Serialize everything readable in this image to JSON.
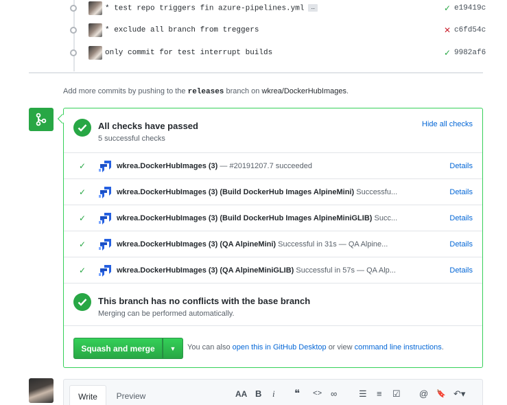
{
  "commits": [
    {
      "message": "* test repo triggers fin azure-pipelines.yml",
      "has_ellipsis": true,
      "ellipsis": "…",
      "status": "success",
      "status_glyph": "✓",
      "sha": "e19419c"
    },
    {
      "message": "* exclude all branch from treggers",
      "status": "failure",
      "status_glyph": "✕",
      "sha": "c6fd54c"
    },
    {
      "message": "only commit for test interrupt builds",
      "status": "success",
      "status_glyph": "✓",
      "sha": "9982af6"
    }
  ],
  "add_more": {
    "prefix": "Add more commits by pushing to the",
    "branch": "releases",
    "middle": "branch on",
    "repo": "wkrea/DockerHubImages",
    "suffix": "."
  },
  "checks": {
    "title": "All checks have passed",
    "subtitle": "5 successful checks",
    "hide_label": "Hide all checks",
    "items": [
      {
        "name": "wkrea.DockerHubImages (3)",
        "desc": "— #20191207.7 succeeded",
        "details": "Details"
      },
      {
        "name": "wkrea.DockerHubImages (3) (Build DockerHub Images AlpineMini)",
        "desc": "Successfu...",
        "details": "Details"
      },
      {
        "name": "wkrea.DockerHubImages (3) (Build DockerHub Images AlpineMiniGLIB)",
        "desc": "Succ...",
        "details": "Details"
      },
      {
        "name": "wkrea.DockerHubImages (3) (QA AlpineMini)",
        "desc": "Successful in 31s — QA Alpine...",
        "details": "Details"
      },
      {
        "name": "wkrea.DockerHubImages (3) (QA AlpineMiniGLIB)",
        "desc": "Successful in 57s — QA Alp...",
        "details": "Details"
      }
    ]
  },
  "conflicts": {
    "title": "This branch has no conflicts with the base branch",
    "subtitle": "Merging can be performed automatically."
  },
  "merge": {
    "button_label": "Squash and merge",
    "caret": "▼",
    "also_prefix": "You can also",
    "desktop_link": "open this in GitHub Desktop",
    "or_view": "or view",
    "cli_link": "command line instructions",
    "suffix": "."
  },
  "comment": {
    "write_tab": "Write",
    "preview_tab": "Preview",
    "toolbar": {
      "heading": "AA",
      "bold": "B",
      "italic": "i",
      "quote": "❝",
      "code": "<>",
      "link": "∞",
      "bullet_list": "☰",
      "numbered_list": "≡",
      "task_list": "☑",
      "mention": "@",
      "saved_reply": "🔖",
      "reply": "↶▾"
    }
  },
  "colors": {
    "success": "#28a745",
    "failure": "#cb2431",
    "link": "#0366d6",
    "border_green": "#34d058"
  }
}
